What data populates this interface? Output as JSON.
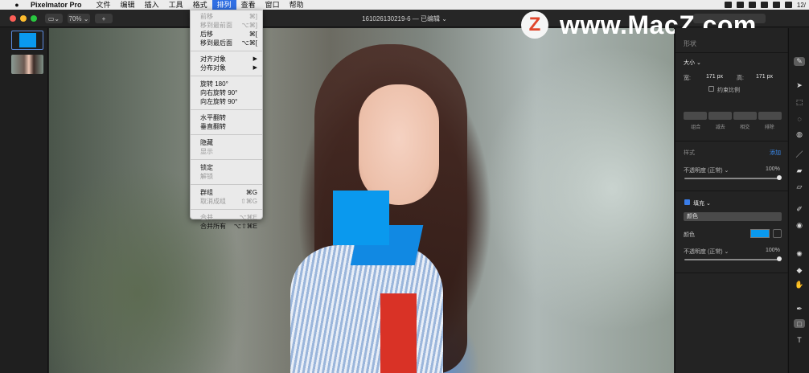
{
  "menubar": {
    "apple": "",
    "app": "Pixelmator Pro",
    "items": [
      "文件",
      "编辑",
      "插入",
      "工具",
      "格式",
      "排列",
      "查看",
      "窗口",
      "帮助"
    ],
    "active_index": 5,
    "clock": "12/"
  },
  "toolbar": {
    "zoom": "70% ⌄",
    "add": "+",
    "title": "161026130219-6 — 已编辑 ⌄"
  },
  "arrange_menu": [
    {
      "label": "前移",
      "shortcut": "⌘]",
      "enabled": false
    },
    {
      "label": "移到最前面",
      "shortcut": "⌥⌘]",
      "enabled": false
    },
    {
      "label": "后移",
      "shortcut": "⌘[",
      "enabled": true
    },
    {
      "label": "移到最后面",
      "shortcut": "⌥⌘[",
      "enabled": true
    },
    {
      "sep": true
    },
    {
      "label": "对齐对象",
      "submenu": true,
      "enabled": true
    },
    {
      "label": "分布对象",
      "submenu": true,
      "enabled": true
    },
    {
      "sep": true
    },
    {
      "label": "旋转 180°",
      "enabled": true
    },
    {
      "label": "向右旋转 90°",
      "enabled": true
    },
    {
      "label": "向左旋转 90°",
      "enabled": true
    },
    {
      "sep": true
    },
    {
      "label": "水平翻转",
      "enabled": true
    },
    {
      "label": "垂直翻转",
      "enabled": true
    },
    {
      "sep": true
    },
    {
      "label": "隐藏",
      "enabled": true
    },
    {
      "label": "显示",
      "enabled": false
    },
    {
      "sep": true
    },
    {
      "label": "锁定",
      "enabled": true
    },
    {
      "label": "解锁",
      "enabled": false
    },
    {
      "sep": true
    },
    {
      "label": "群组",
      "shortcut": "⌘G",
      "enabled": true
    },
    {
      "label": "取消成组",
      "shortcut": "⇧⌘G",
      "enabled": false
    },
    {
      "sep": true
    },
    {
      "label": "合并",
      "shortcut": "⌥⌘E",
      "enabled": false
    },
    {
      "label": "合并所有",
      "shortcut": "⌥⇧⌘E",
      "enabled": true
    }
  ],
  "watermark": {
    "logo": "Z",
    "text": "www.MacZ.com"
  },
  "inspector": {
    "section": "形状",
    "size_label": "大小 ⌄",
    "width_label": "宽:",
    "width_value": "171 px",
    "height_label": "高:",
    "height_value": "171 px",
    "constrain": "约束比例",
    "ops": [
      "组合",
      "减去",
      "相交",
      "排除"
    ],
    "style_label": "样式",
    "add_label": "添加",
    "opacity_label": "不透明度 (正常) ⌄",
    "opacity_value": "100%",
    "fill_label": "填充 ⌄",
    "fill_type": "颜色",
    "color_label": "颜色",
    "opacity2_label": "不透明度 (正常) ⌄",
    "opacity2_value": "100%",
    "fill_color": "#0a99ee"
  },
  "tools": [
    "format-brush-icon",
    "arrow-icon",
    "selection-icon",
    "lasso-icon",
    "color-picker-icon",
    "brush-icon",
    "bucket-icon",
    "eraser-icon",
    "retouch-icon",
    "clone-icon",
    "lighten-icon",
    "sharpen-icon",
    "smudge-icon",
    "pen-icon",
    "shape-icon",
    "text-icon"
  ]
}
